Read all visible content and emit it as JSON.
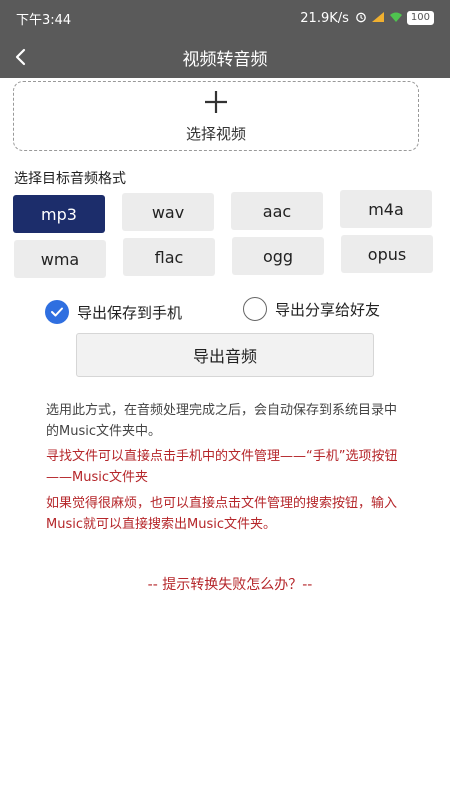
{
  "status_bar": {
    "time": "下午3:44",
    "network_speed": "21.9K/s",
    "battery": "100"
  },
  "header": {
    "title": "视频转音频",
    "back_icon": "chevron-left-icon"
  },
  "select_video": {
    "icon": "plus-icon",
    "label": "选择视频"
  },
  "formats": {
    "heading": "选择目标音频格式",
    "items": [
      "mp3",
      "wav",
      "aac",
      "m4a",
      "wma",
      "flac",
      "ogg",
      "opus"
    ],
    "selected": "mp3"
  },
  "options": {
    "save_to_phone": "导出保存到手机",
    "share_to_friend": "导出分享给好友",
    "selected": "save_to_phone"
  },
  "export_button": {
    "label": "导出音频"
  },
  "notes": {
    "info": "选用此方式，在音频处理完成之后，会自动保存到系统目录中的Music文件夹中。",
    "tip1": "寻找文件可以直接点击手机中的文件管理——“手机”选项按钮——Music文件夹",
    "tip2": "如果觉得很麻烦，也可以直接点击文件管理的搜索按钮，输入Music就可以直接搜索出Music文件夹。"
  },
  "help_link": "-- 提示转换失败怎么办？--",
  "colors": {
    "header_bg": "#5a5a5a",
    "selected_format": "#1c2d6b",
    "radio_checked": "#2f6fe0",
    "tip_red": "#b5262a"
  }
}
